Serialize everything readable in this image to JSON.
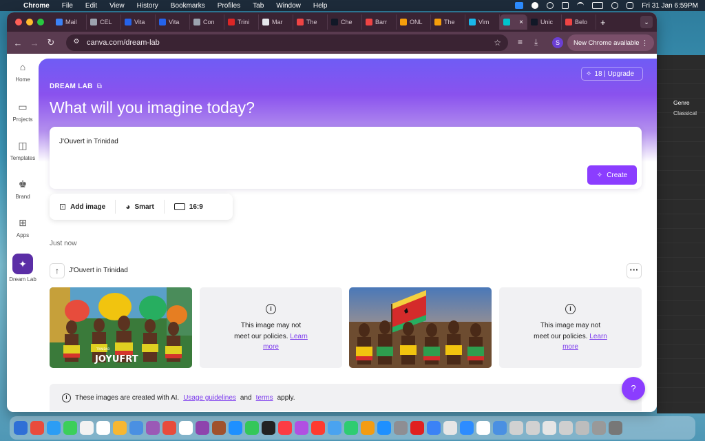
{
  "menubar": {
    "app": "Chrome",
    "items": [
      "File",
      "Edit",
      "View",
      "History",
      "Bookmarks",
      "Profiles",
      "Tab",
      "Window",
      "Help"
    ],
    "clock": "Fri 31 Jan  6:59PM"
  },
  "tabs": [
    {
      "label": "Mail",
      "color": "#3b82f6"
    },
    {
      "label": "CEL",
      "color": "#9ca3af"
    },
    {
      "label": "Vita",
      "color": "#2563eb"
    },
    {
      "label": "Vita",
      "color": "#2563eb"
    },
    {
      "label": "Con",
      "color": "#9ca3af"
    },
    {
      "label": "Trini",
      "color": "#dc2626"
    },
    {
      "label": "Mar",
      "color": "#e5e7eb"
    },
    {
      "label": "The",
      "color": "#ef4444"
    },
    {
      "label": "Che",
      "color": "#111827"
    },
    {
      "label": "Barr",
      "color": "#ef4444"
    },
    {
      "label": "ONL",
      "color": "#f59e0b"
    },
    {
      "label": "The",
      "color": "#f59e0b"
    },
    {
      "label": "Vim",
      "color": "#1ab7ea"
    },
    {
      "label": "",
      "color": "#00c4cc",
      "active": true
    },
    {
      "label": "Unic",
      "color": "#111827"
    },
    {
      "label": "Belo",
      "color": "#ef4444"
    }
  ],
  "toolbar": {
    "url": "canva.com/dream-lab",
    "profile_initial": "S",
    "new_chrome": "New Chrome available"
  },
  "sidenav": [
    {
      "label": "Home",
      "icon": "home-icon",
      "glyph": "⌂"
    },
    {
      "label": "Projects",
      "icon": "folder-icon",
      "glyph": "▭"
    },
    {
      "label": "Templates",
      "icon": "templates-icon",
      "glyph": "◫"
    },
    {
      "label": "Brand",
      "icon": "brand-icon",
      "glyph": "♚"
    },
    {
      "label": "Apps",
      "icon": "apps-icon",
      "glyph": "⊞"
    },
    {
      "label": "Dream Lab",
      "icon": "dream-lab-icon",
      "glyph": "✦"
    }
  ],
  "hero": {
    "kicker": "DREAM LAB",
    "title": "What will you imagine today?",
    "credits": "18 | Upgrade"
  },
  "prompt": {
    "text": "J'Ouvert in Trinidad",
    "create": "Create"
  },
  "options": {
    "add_image": "Add image",
    "style": "Smart",
    "ratio": "16:9"
  },
  "results": {
    "time": "Just now",
    "title": "J'Ouvert in Trinidad",
    "photo1_caption": "JOYUFRT",
    "photo1_small": "TRINIDAD",
    "blocked_line1": "This image may not",
    "blocked_line2": "meet our policies.",
    "learn": "Learn",
    "more": "more"
  },
  "notice": {
    "pre": "These images are created with AI.",
    "link1": "Usage guidelines",
    "mid": "and",
    "link2": "terms",
    "post": "apply."
  },
  "help": "?",
  "bgapp": {
    "genre": "Genre",
    "value": "Classical"
  },
  "colors": {
    "brand_purple": "#8b3dff",
    "link_purple": "#7c3aed",
    "chrome_frame": "#3a2333"
  }
}
